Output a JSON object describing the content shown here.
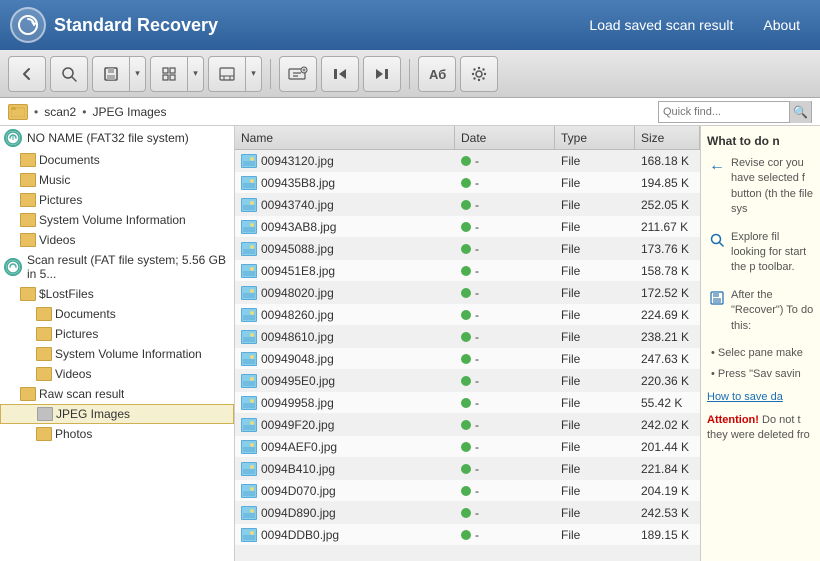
{
  "header": {
    "title": "Standard Recovery",
    "logo_symbol": "⟳",
    "nav": {
      "load_scan": "Load saved scan result",
      "about": "About"
    }
  },
  "toolbar": {
    "back_tooltip": "Back",
    "search_tooltip": "Search",
    "save_tooltip": "Save",
    "view_tooltip": "View",
    "preview_tooltip": "Preview",
    "find_tooltip": "Find",
    "prev_tooltip": "Previous",
    "next_tooltip": "Next",
    "rename_tooltip": "Rename",
    "settings_tooltip": "Settings"
  },
  "breadcrumb": {
    "icon": "📁",
    "path1": "scan2",
    "path2": "JPEG Images",
    "search_placeholder": "Quick find..."
  },
  "tree": {
    "items": [
      {
        "level": 0,
        "type": "drive",
        "label": "NO NAME (FAT32 file system)",
        "icon": "drive"
      },
      {
        "level": 1,
        "type": "folder",
        "label": "Documents"
      },
      {
        "level": 1,
        "type": "folder",
        "label": "Music"
      },
      {
        "level": 1,
        "type": "folder",
        "label": "Pictures"
      },
      {
        "level": 1,
        "type": "folder",
        "label": "System Volume Information"
      },
      {
        "level": 1,
        "type": "folder",
        "label": "Videos"
      },
      {
        "level": 0,
        "type": "scan",
        "label": "Scan result (FAT file system; 5.56 GB in 5..."
      },
      {
        "level": 1,
        "type": "folder",
        "label": "$LostFiles"
      },
      {
        "level": 2,
        "type": "folder",
        "label": "Documents"
      },
      {
        "level": 2,
        "type": "folder",
        "label": "Pictures"
      },
      {
        "level": 2,
        "type": "folder",
        "label": "System Volume Information"
      },
      {
        "level": 2,
        "type": "folder",
        "label": "Videos"
      },
      {
        "level": 1,
        "type": "folder",
        "label": "Raw scan result"
      },
      {
        "level": 2,
        "type": "folder",
        "label": "JPEG Images",
        "selected": true
      },
      {
        "level": 2,
        "type": "folder",
        "label": "Photos"
      }
    ]
  },
  "file_list": {
    "columns": [
      "Name",
      "Date",
      "Type",
      "Size"
    ],
    "files": [
      {
        "name": "00943120.jpg",
        "date": "-",
        "type": "File",
        "size": "168.18 K",
        "status": "green"
      },
      {
        "name": "009435B8.jpg",
        "date": "-",
        "type": "File",
        "size": "194.85 K",
        "status": "green"
      },
      {
        "name": "00943740.jpg",
        "date": "-",
        "type": "File",
        "size": "252.05 K",
        "status": "green"
      },
      {
        "name": "00943AB8.jpg",
        "date": "-",
        "type": "File",
        "size": "211.67 K",
        "status": "green"
      },
      {
        "name": "00945088.jpg",
        "date": "-",
        "type": "File",
        "size": "173.76 K",
        "status": "green"
      },
      {
        "name": "009451E8.jpg",
        "date": "-",
        "type": "File",
        "size": "158.78 K",
        "status": "green"
      },
      {
        "name": "00948020.jpg",
        "date": "-",
        "type": "File",
        "size": "172.52 K",
        "status": "green"
      },
      {
        "name": "00948260.jpg",
        "date": "-",
        "type": "File",
        "size": "224.69 K",
        "status": "green"
      },
      {
        "name": "00948610.jpg",
        "date": "-",
        "type": "File",
        "size": "238.21 K",
        "status": "green"
      },
      {
        "name": "00949048.jpg",
        "date": "-",
        "type": "File",
        "size": "247.63 K",
        "status": "green"
      },
      {
        "name": "009495E0.jpg",
        "date": "-",
        "type": "File",
        "size": "220.36 K",
        "status": "green"
      },
      {
        "name": "00949958.jpg",
        "date": "-",
        "type": "File",
        "size": "55.42 K",
        "status": "green"
      },
      {
        "name": "00949F20.jpg",
        "date": "-",
        "type": "File",
        "size": "242.02 K",
        "status": "green"
      },
      {
        "name": "0094AEF0.jpg",
        "date": "-",
        "type": "File",
        "size": "201.44 K",
        "status": "green"
      },
      {
        "name": "0094B410.jpg",
        "date": "-",
        "type": "File",
        "size": "221.84 K",
        "status": "green"
      },
      {
        "name": "0094D070.jpg",
        "date": "-",
        "type": "File",
        "size": "204.19 K",
        "status": "green"
      },
      {
        "name": "0094D890.jpg",
        "date": "-",
        "type": "File",
        "size": "242.53 K",
        "status": "green"
      },
      {
        "name": "0094DDB0.jpg",
        "date": "-",
        "type": "File",
        "size": "189.15 K",
        "status": "green"
      }
    ]
  },
  "info_panel": {
    "title": "What to do n",
    "back_icon": "←",
    "search_icon": "🔍",
    "save_icon": "💾",
    "bullet_icon": "•",
    "sections": [
      {
        "icon": "←",
        "text": "Revise cor you have selected f button (th the file sys"
      },
      {
        "icon": "🔍",
        "text": "Explore fil looking for start the p toolbar."
      },
      {
        "icon": "💾",
        "text": "After the \"Recover\") To do this:"
      }
    ],
    "bullet1": "Selec pane make",
    "bullet2": "Press \"Sav savin",
    "link": "How to save da",
    "attention": "Attention!",
    "attention_text": "Do not t they were deleted fro"
  }
}
